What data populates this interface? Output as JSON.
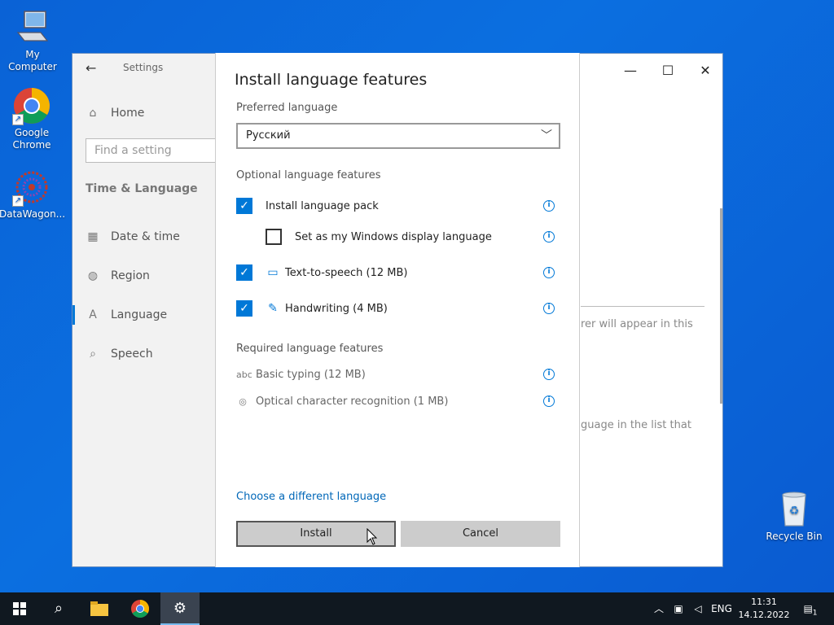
{
  "desktop": {
    "icons": [
      {
        "label": "My Computer"
      },
      {
        "label": "Google Chrome"
      },
      {
        "label": "DataWagon..."
      },
      {
        "label": "Recycle Bin"
      }
    ]
  },
  "settings": {
    "title": "Settings",
    "home": "Home",
    "search_placeholder": "Find a setting",
    "section": "Time & Language",
    "nav": [
      {
        "label": "Date & time",
        "icon": "calendar-icon"
      },
      {
        "label": "Region",
        "icon": "globe-icon"
      },
      {
        "label": "Language",
        "icon": "language-icon"
      },
      {
        "label": "Speech",
        "icon": "microphone-icon"
      }
    ],
    "bg_text_1": "rer will appear in this",
    "bg_text_2": "guage in the list that"
  },
  "dialog": {
    "title": "Install language features",
    "preferred_label": "Preferred language",
    "preferred_value": "Русский",
    "optional_label": "Optional language features",
    "optional": [
      {
        "label": "Install language pack",
        "checked": true
      },
      {
        "label": "Set as my Windows display language",
        "checked": false
      },
      {
        "label": "Text-to-speech (12 MB)",
        "checked": true
      },
      {
        "label": "Handwriting (4 MB)",
        "checked": true
      }
    ],
    "required_label": "Required language features",
    "required": [
      {
        "label": "Basic typing (12 MB)",
        "icon_text": "abc"
      },
      {
        "label": "Optical character recognition (1 MB)"
      }
    ],
    "link": "Choose a different language",
    "install": "Install",
    "cancel": "Cancel"
  },
  "taskbar": {
    "lang": "ENG",
    "time": "11:31",
    "date": "14.12.2022",
    "notif_count": "1"
  },
  "colors": {
    "accent": "#0078d7",
    "link": "#0067b8",
    "desktop": "#0a62d6",
    "taskbar": "#101820"
  }
}
